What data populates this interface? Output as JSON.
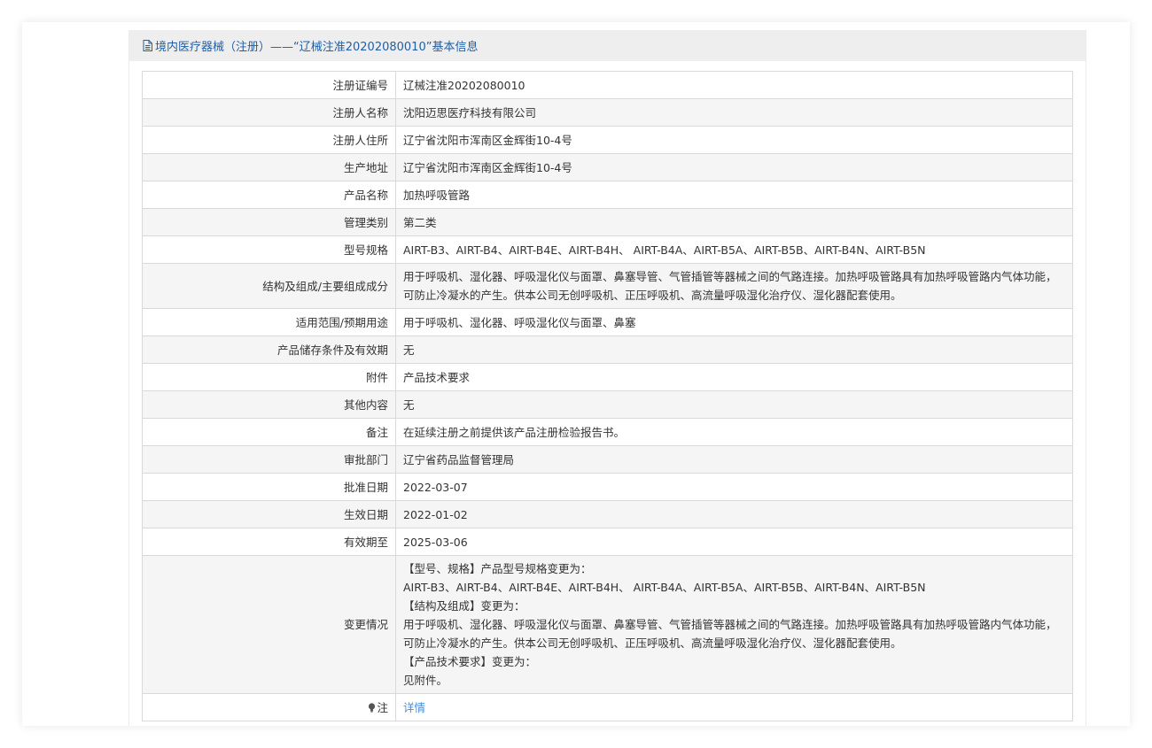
{
  "header": {
    "title": "境内医疗器械（注册）——“辽械注准20202080010”基本信息",
    "icon": "document-icon"
  },
  "rows": [
    {
      "label": "注册证编号",
      "value": "辽械注准20202080010"
    },
    {
      "label": "注册人名称",
      "value": "沈阳迈思医疗科技有限公司"
    },
    {
      "label": "注册人住所",
      "value": "辽宁省沈阳市浑南区金辉街10-4号"
    },
    {
      "label": "生产地址",
      "value": "辽宁省沈阳市浑南区金辉街10-4号"
    },
    {
      "label": "产品名称",
      "value": "加热呼吸管路"
    },
    {
      "label": "管理类别",
      "value": "第二类"
    },
    {
      "label": "型号规格",
      "value": "AIRT-B3、AIRT-B4、AIRT-B4E、AIRT-B4H、 AIRT-B4A、AIRT-B5A、AIRT-B5B、AIRT-B4N、AIRT-B5N"
    },
    {
      "label": "结构及组成/主要组成成分",
      "value_lines": [
        "用于呼吸机、湿化器、呼吸湿化仪与面罩、鼻塞导管、气管插管等器械之间的气路连接。加热呼吸管路具有加热呼吸管路内气体功能，",
        "可防止冷凝水的产生。供本公司无创呼吸机、正压呼吸机、高流量呼吸湿化治疗仪、湿化器配套使用。"
      ]
    },
    {
      "label": "适用范围/预期用途",
      "value": "用于呼吸机、湿化器、呼吸湿化仪与面罩、鼻塞"
    },
    {
      "label": "产品储存条件及有效期",
      "value": "无"
    },
    {
      "label": "附件",
      "value": "产品技术要求"
    },
    {
      "label": "其他内容",
      "value": "无"
    },
    {
      "label": "备注",
      "value": "在延续注册之前提供该产品注册检验报告书。"
    },
    {
      "label": "审批部门",
      "value": "辽宁省药品监督管理局"
    },
    {
      "label": "批准日期",
      "value": "2022-03-07"
    },
    {
      "label": "生效日期",
      "value": "2022-01-02"
    },
    {
      "label": "有效期至",
      "value": "2025-03-06"
    },
    {
      "label": "变更情况",
      "value_lines": [
        "【型号、规格】产品型号规格变更为：",
        "AIRT-B3、AIRT-B4、AIRT-B4E、AIRT-B4H、 AIRT-B4A、AIRT-B5A、AIRT-B5B、AIRT-B4N、AIRT-B5N",
        "【结构及组成】变更为：",
        "用于呼吸机、湿化器、呼吸湿化仪与面罩、鼻塞导管、气管插管等器械之间的气路连接。加热呼吸管路具有加热呼吸管路内气体功能，",
        "可防止冷凝水的产生。供本公司无创呼吸机、正压呼吸机、高流量呼吸湿化治疗仪、湿化器配套使用。",
        "【产品技术要求】变更为：",
        "见附件。"
      ]
    }
  ],
  "note_row": {
    "label": "注",
    "link_text": "详情",
    "icon": "lightbulb-icon"
  },
  "colors": {
    "title": "#1f5fa8",
    "link": "#3a8ee6",
    "header_bg": "#eeeeee",
    "row_alt_bg": "#f5f5f5",
    "border": "#d9d9d9"
  }
}
